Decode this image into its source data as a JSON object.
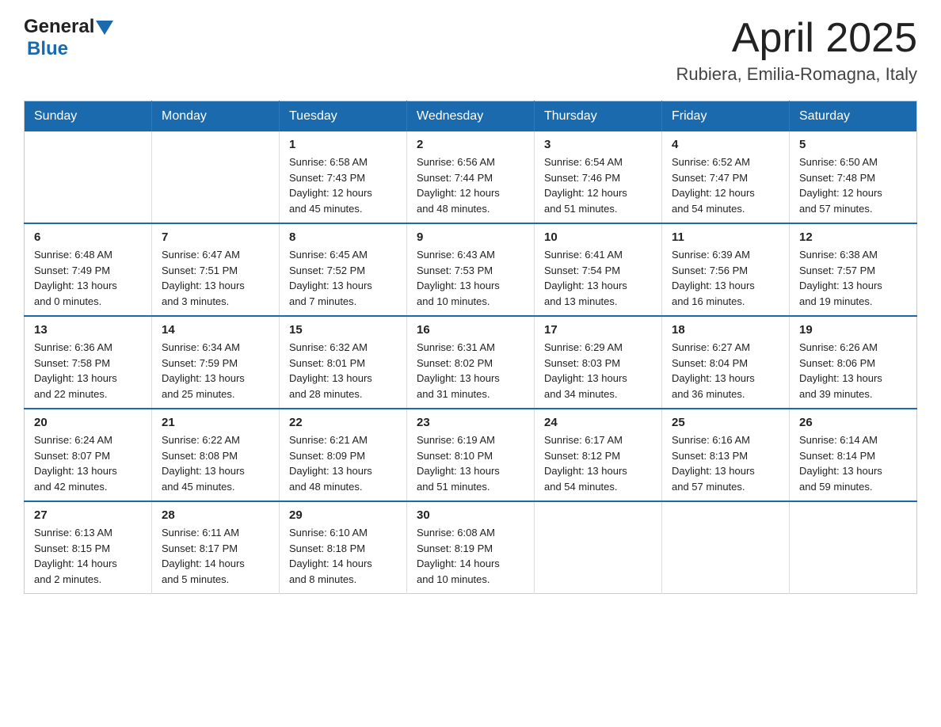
{
  "header": {
    "logo_general": "General",
    "logo_blue": "Blue",
    "month_title": "April 2025",
    "location": "Rubiera, Emilia-Romagna, Italy"
  },
  "days_of_week": [
    "Sunday",
    "Monday",
    "Tuesday",
    "Wednesday",
    "Thursday",
    "Friday",
    "Saturday"
  ],
  "weeks": [
    [
      {
        "day": "",
        "info": ""
      },
      {
        "day": "",
        "info": ""
      },
      {
        "day": "1",
        "info": "Sunrise: 6:58 AM\nSunset: 7:43 PM\nDaylight: 12 hours\nand 45 minutes."
      },
      {
        "day": "2",
        "info": "Sunrise: 6:56 AM\nSunset: 7:44 PM\nDaylight: 12 hours\nand 48 minutes."
      },
      {
        "day": "3",
        "info": "Sunrise: 6:54 AM\nSunset: 7:46 PM\nDaylight: 12 hours\nand 51 minutes."
      },
      {
        "day": "4",
        "info": "Sunrise: 6:52 AM\nSunset: 7:47 PM\nDaylight: 12 hours\nand 54 minutes."
      },
      {
        "day": "5",
        "info": "Sunrise: 6:50 AM\nSunset: 7:48 PM\nDaylight: 12 hours\nand 57 minutes."
      }
    ],
    [
      {
        "day": "6",
        "info": "Sunrise: 6:48 AM\nSunset: 7:49 PM\nDaylight: 13 hours\nand 0 minutes."
      },
      {
        "day": "7",
        "info": "Sunrise: 6:47 AM\nSunset: 7:51 PM\nDaylight: 13 hours\nand 3 minutes."
      },
      {
        "day": "8",
        "info": "Sunrise: 6:45 AM\nSunset: 7:52 PM\nDaylight: 13 hours\nand 7 minutes."
      },
      {
        "day": "9",
        "info": "Sunrise: 6:43 AM\nSunset: 7:53 PM\nDaylight: 13 hours\nand 10 minutes."
      },
      {
        "day": "10",
        "info": "Sunrise: 6:41 AM\nSunset: 7:54 PM\nDaylight: 13 hours\nand 13 minutes."
      },
      {
        "day": "11",
        "info": "Sunrise: 6:39 AM\nSunset: 7:56 PM\nDaylight: 13 hours\nand 16 minutes."
      },
      {
        "day": "12",
        "info": "Sunrise: 6:38 AM\nSunset: 7:57 PM\nDaylight: 13 hours\nand 19 minutes."
      }
    ],
    [
      {
        "day": "13",
        "info": "Sunrise: 6:36 AM\nSunset: 7:58 PM\nDaylight: 13 hours\nand 22 minutes."
      },
      {
        "day": "14",
        "info": "Sunrise: 6:34 AM\nSunset: 7:59 PM\nDaylight: 13 hours\nand 25 minutes."
      },
      {
        "day": "15",
        "info": "Sunrise: 6:32 AM\nSunset: 8:01 PM\nDaylight: 13 hours\nand 28 minutes."
      },
      {
        "day": "16",
        "info": "Sunrise: 6:31 AM\nSunset: 8:02 PM\nDaylight: 13 hours\nand 31 minutes."
      },
      {
        "day": "17",
        "info": "Sunrise: 6:29 AM\nSunset: 8:03 PM\nDaylight: 13 hours\nand 34 minutes."
      },
      {
        "day": "18",
        "info": "Sunrise: 6:27 AM\nSunset: 8:04 PM\nDaylight: 13 hours\nand 36 minutes."
      },
      {
        "day": "19",
        "info": "Sunrise: 6:26 AM\nSunset: 8:06 PM\nDaylight: 13 hours\nand 39 minutes."
      }
    ],
    [
      {
        "day": "20",
        "info": "Sunrise: 6:24 AM\nSunset: 8:07 PM\nDaylight: 13 hours\nand 42 minutes."
      },
      {
        "day": "21",
        "info": "Sunrise: 6:22 AM\nSunset: 8:08 PM\nDaylight: 13 hours\nand 45 minutes."
      },
      {
        "day": "22",
        "info": "Sunrise: 6:21 AM\nSunset: 8:09 PM\nDaylight: 13 hours\nand 48 minutes."
      },
      {
        "day": "23",
        "info": "Sunrise: 6:19 AM\nSunset: 8:10 PM\nDaylight: 13 hours\nand 51 minutes."
      },
      {
        "day": "24",
        "info": "Sunrise: 6:17 AM\nSunset: 8:12 PM\nDaylight: 13 hours\nand 54 minutes."
      },
      {
        "day": "25",
        "info": "Sunrise: 6:16 AM\nSunset: 8:13 PM\nDaylight: 13 hours\nand 57 minutes."
      },
      {
        "day": "26",
        "info": "Sunrise: 6:14 AM\nSunset: 8:14 PM\nDaylight: 13 hours\nand 59 minutes."
      }
    ],
    [
      {
        "day": "27",
        "info": "Sunrise: 6:13 AM\nSunset: 8:15 PM\nDaylight: 14 hours\nand 2 minutes."
      },
      {
        "day": "28",
        "info": "Sunrise: 6:11 AM\nSunset: 8:17 PM\nDaylight: 14 hours\nand 5 minutes."
      },
      {
        "day": "29",
        "info": "Sunrise: 6:10 AM\nSunset: 8:18 PM\nDaylight: 14 hours\nand 8 minutes."
      },
      {
        "day": "30",
        "info": "Sunrise: 6:08 AM\nSunset: 8:19 PM\nDaylight: 14 hours\nand 10 minutes."
      },
      {
        "day": "",
        "info": ""
      },
      {
        "day": "",
        "info": ""
      },
      {
        "day": "",
        "info": ""
      }
    ]
  ]
}
